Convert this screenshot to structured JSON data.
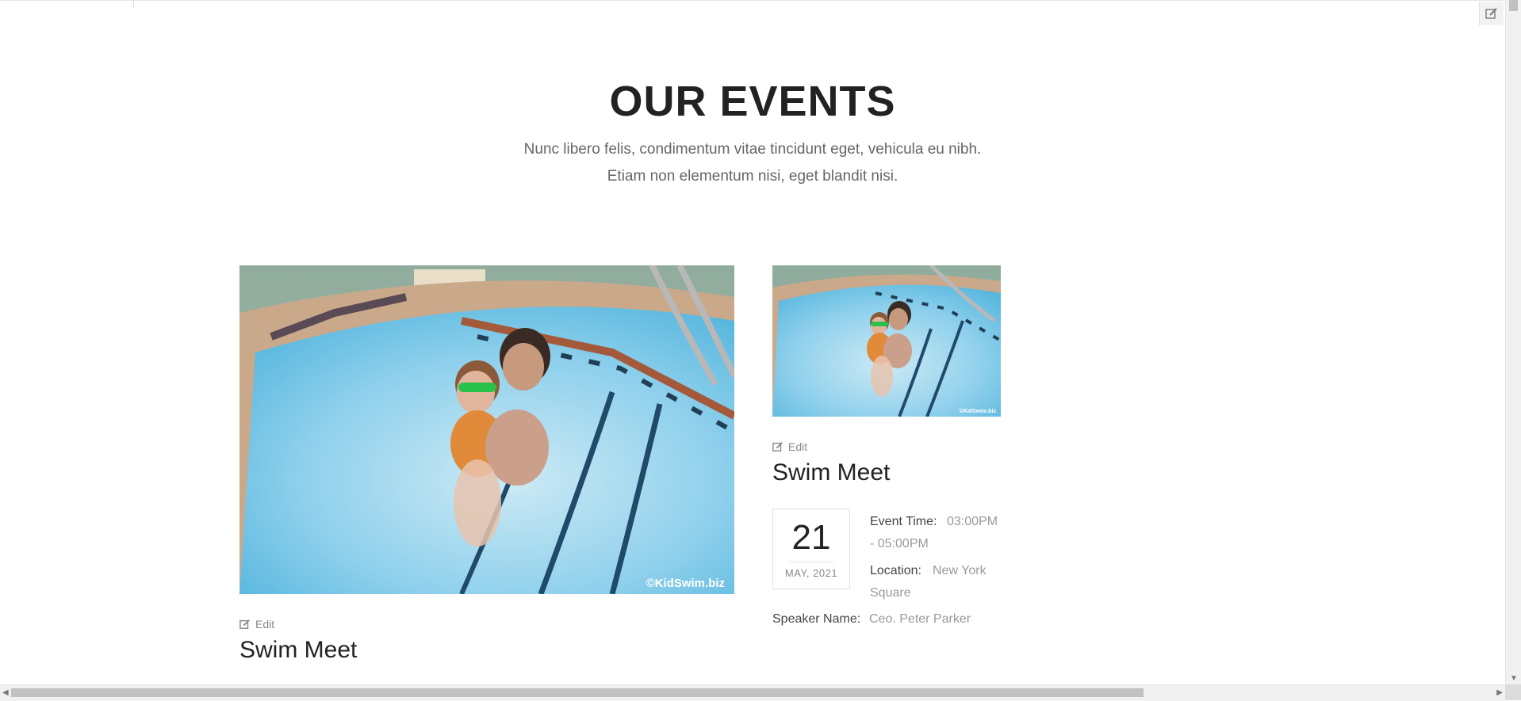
{
  "section": {
    "title": "OUR EVENTS",
    "subtitle_line1": "Nunc libero felis, condimentum vitae tincidunt eget, vehicula eu nibh.",
    "subtitle_line2": "Etiam non elementum nisi, eget blandit nisi."
  },
  "events": [
    {
      "edit_label": "Edit",
      "title": "Swim Meet",
      "image_watermark": "©KidSwim.biz"
    },
    {
      "edit_label": "Edit",
      "title": "Swim Meet",
      "image_watermark": "©KidSwim.biz",
      "date_day": "21",
      "date_month": "MAY, 2021",
      "time_label": "Event Time:",
      "time_value_a": "03:00PM",
      "time_value_b": "- 05:00PM",
      "location_label": "Location:",
      "location_value_a": "New York",
      "location_value_b": "Square",
      "speaker_label": "Speaker Name:",
      "speaker_value": "Ceo. Peter Parker"
    }
  ],
  "icons": {
    "edit": "edit-icon",
    "corner_edit": "edit-icon"
  },
  "colors": {
    "title": "#222222",
    "muted": "#999999",
    "pool": "#7cc9e6"
  }
}
